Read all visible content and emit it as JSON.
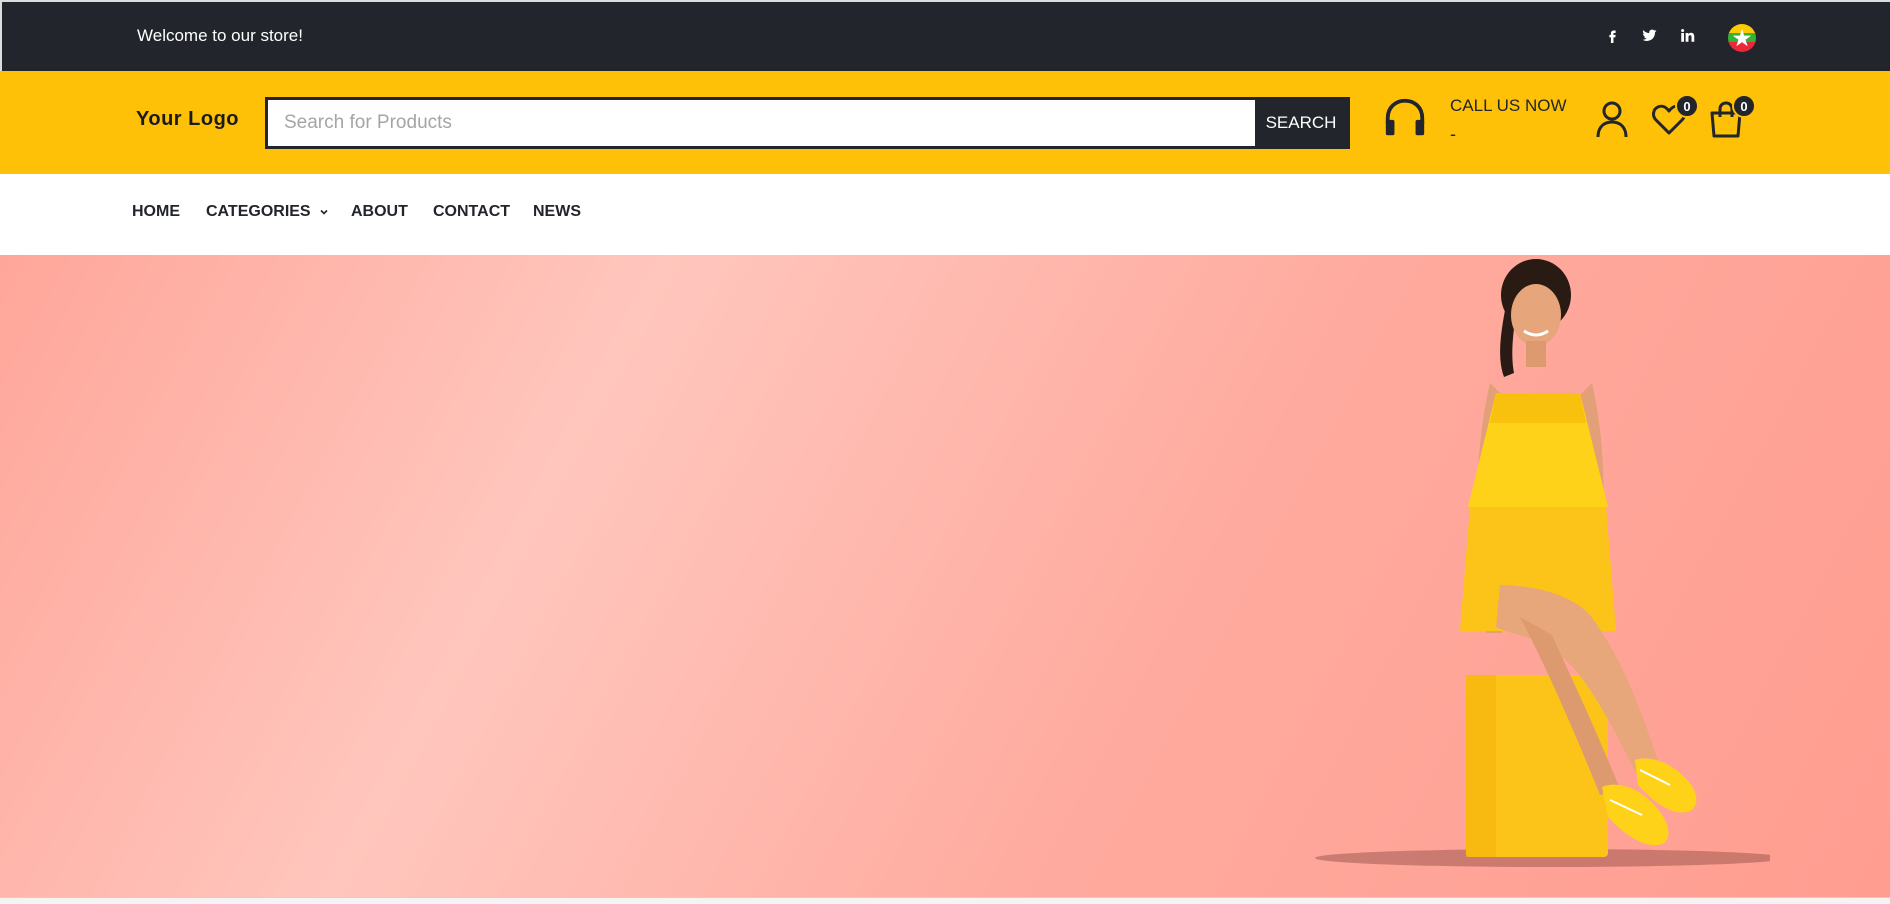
{
  "topbar": {
    "welcome_text": "Welcome to our store!",
    "social_icons": [
      "facebook-icon",
      "twitter-icon",
      "linkedin-icon"
    ],
    "flag_icon": "myanmar-flag-icon"
  },
  "header": {
    "logo_text": "Your Logo",
    "search_placeholder": "Search for Products",
    "search_button": "SEARCH",
    "call_label": "CALL US NOW",
    "call_number": "-",
    "wishlist_count": "0",
    "cart_count": "0"
  },
  "nav": {
    "items": [
      {
        "label": "HOME"
      },
      {
        "label": "CATEGORIES"
      },
      {
        "label": "ABOUT"
      },
      {
        "label": "CONTACT"
      },
      {
        "label": "NEWS"
      }
    ]
  },
  "colors": {
    "topbar_bg": "#22252b",
    "header_bg": "#ffc107",
    "hero_bg": "#ffb0a5",
    "accent_dark": "#22252b"
  }
}
